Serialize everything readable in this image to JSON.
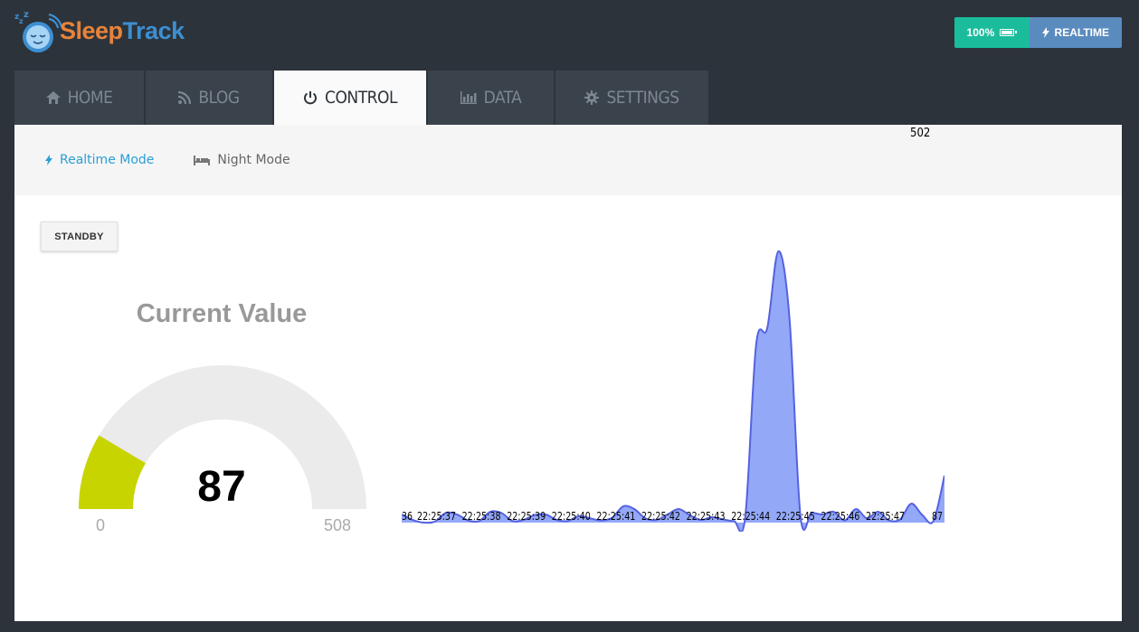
{
  "header": {
    "app_name_part1": "Sleep",
    "app_name_part2": "Track",
    "battery_label": "100%",
    "realtime_label": "REALTIME"
  },
  "tabs": [
    {
      "label": "HOME",
      "icon": "home-icon"
    },
    {
      "label": "BLOG",
      "icon": "rss-icon"
    },
    {
      "label": "CONTROL",
      "icon": "power-icon"
    },
    {
      "label": "DATA",
      "icon": "bar-chart-icon"
    },
    {
      "label": "SETTINGS",
      "icon": "gear-icon"
    }
  ],
  "active_tab": "CONTROL",
  "subnav": {
    "realtime_label": "Realtime Mode",
    "night_label": "Night Mode"
  },
  "standby_label": "STANDBY",
  "gauge": {
    "title": "Current Value",
    "value": "87",
    "min": "0",
    "max": "508",
    "fill_color": "#c8d400",
    "track_color": "#ebebeb"
  },
  "chart_data": {
    "type": "area",
    "x_tick_labels": [
      "22:25:37",
      "22:25:38",
      "22:25:39",
      "22:25:40",
      "22:25:41",
      "22:25:42",
      "22:25:43",
      "22:25:44",
      "22:25:45",
      "22:25:46",
      "22:25:47"
    ],
    "left_edge_label": "36",
    "last_value_label": "87",
    "max_value_label": "502",
    "values": [
      15,
      5,
      0,
      2,
      18,
      15,
      4,
      3,
      20,
      18,
      3,
      5,
      14,
      15,
      5,
      3,
      12,
      8,
      4,
      9,
      30,
      25,
      8,
      5,
      15,
      25,
      14,
      5,
      10,
      6,
      3,
      8,
      330,
      360,
      502,
      380,
      12,
      18,
      15,
      20,
      4,
      25,
      8,
      20,
      4,
      6,
      35,
      14,
      3,
      87
    ],
    "ylim": [
      0,
      502
    ],
    "fill_color": "#94a8f8",
    "line_color": "#5562e0"
  }
}
